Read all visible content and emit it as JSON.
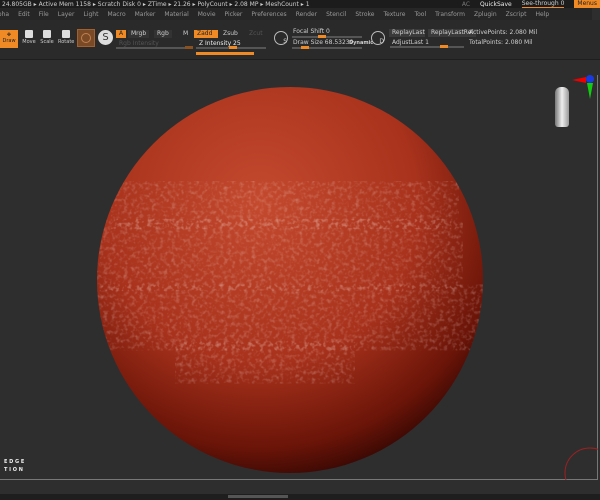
{
  "status": {
    "text": "24.805GB ▸ Active Mem 1158 ▸ Scratch Disk 0 ▸  ZTime ▸ 21.26 ▸ PolyCount ▸ 2.08 MP  ▸ MeshCount ▸ 1",
    "ac": "AC",
    "quicksave": "QuickSave",
    "see_through": "See-through  0",
    "menus": "Menus"
  },
  "menubar": [
    "Alpha",
    "Edit",
    "File",
    "Layer",
    "Light",
    "Macro",
    "Marker",
    "Material",
    "Movie",
    "Picker",
    "Preferences",
    "Render",
    "Stencil",
    "Stroke",
    "Texture",
    "Tool",
    "Transform",
    "Zplugin",
    "Zscript",
    "Help"
  ],
  "toolbar": {
    "draw": "Draw",
    "move": "Move",
    "scale": "Scale",
    "rotate": "Rotate",
    "a": "A",
    "mrgb": "Mrgb",
    "rgb": "Rgb",
    "m": "M",
    "rgb_intensity": "Rgb Intensity",
    "zadd": "Zadd",
    "zsub": "Zsub",
    "zcut": "Zcut",
    "z_intensity": "Z Intensity 25",
    "focal_shift": "Focal Shift 0",
    "draw_size": "Draw Size 68.53239",
    "dynamic": "Dynamic",
    "replay_last": "ReplayLast",
    "replay_last_rel": "ReplayLastRel",
    "adjust_last": "AdjustLast 1",
    "active_points": "ActivePoints: 2.080 Mil",
    "total_points": "TotalPoints: 2.080 Mil",
    "s": "S",
    "d": "D"
  },
  "canvas": {
    "label_line1": "E D G E",
    "label_line2": "T I O N"
  },
  "colors": {
    "accent": "#f08a24",
    "clay": "#b23a20"
  }
}
